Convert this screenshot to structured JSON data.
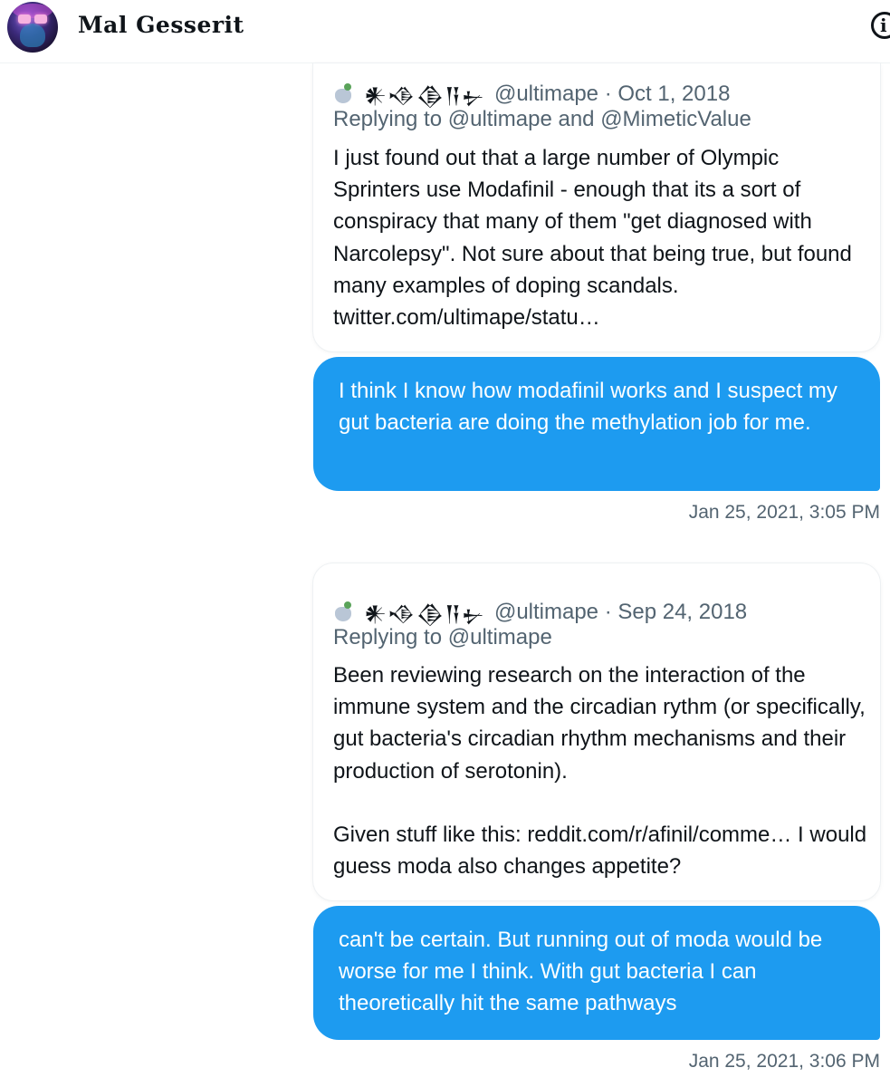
{
  "header": {
    "user_name": "Mal Gesserit",
    "info_icon": "info-icon"
  },
  "messages": [
    {
      "quoted_tweet": {
        "display_name": "𒀭𒈾𒆠𒀀𒉡",
        "handle_date": "@ultimape · Oct 1, 2018",
        "replying_to": "Replying to @ultimape and @MimeticValue",
        "text": "I just found out that a large number of Olympic Sprinters use Modafinil - enough that its a sort of conspiracy that many of them \"get diagnosed with Narcolepsy\". Not sure about that being true, but found many examples of doping scandals. twitter.com/ultimape/statu…"
      },
      "bubble_text": "I think I know how modafinil works and I suspect my gut bacteria are doing the methylation job for me.",
      "timestamp": "Jan 25, 2021, 3:05 PM"
    },
    {
      "quoted_tweet": {
        "display_name": "𒀭𒈾𒆠𒀀𒉡",
        "handle_date": "@ultimape · Sep 24, 2018",
        "replying_to": "Replying to @ultimape",
        "text": "Been reviewing research on the interaction of the immune system and the circadian rythm (or specifically, gut bacteria's circadian rhythm mechanisms and their production of serotonin).\n\nGiven stuff like this: reddit.com/r/afinil/comme… I would guess moda also changes appetite?"
      },
      "bubble_text": "can't be certain. But running out of moda would be worse for me I think. With gut bacteria I can theoretically hit the same pathways",
      "timestamp": "Jan 25, 2021, 3:06 PM"
    }
  ],
  "colors": {
    "bubble_blue": "#1d9bf0",
    "secondary_text": "#536471",
    "primary_text": "#0f1419"
  }
}
